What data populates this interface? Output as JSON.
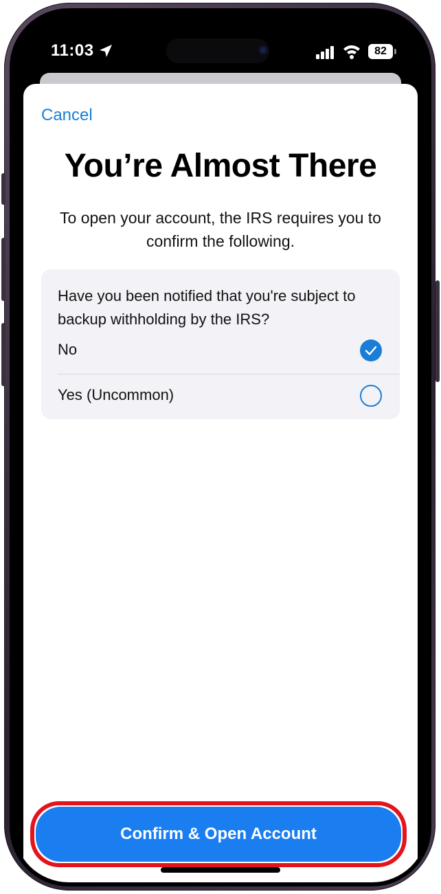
{
  "status_bar": {
    "time": "11:03",
    "battery_level": "82"
  },
  "sheet": {
    "cancel_label": "Cancel",
    "title": "You’re Almost There",
    "subtitle": "To open your account, the IRS requires you to confirm the following.",
    "question": {
      "text": "Have you been notified that you're subject to backup withholding by the IRS?",
      "options": [
        {
          "label": "No",
          "selected": true
        },
        {
          "label": "Yes (Uncommon)",
          "selected": false
        }
      ]
    },
    "primary_button_label": "Confirm & Open Account"
  },
  "colors": {
    "accent": "#1a7ed6",
    "button": "#1a7ef0",
    "highlight": "#e3141c"
  }
}
